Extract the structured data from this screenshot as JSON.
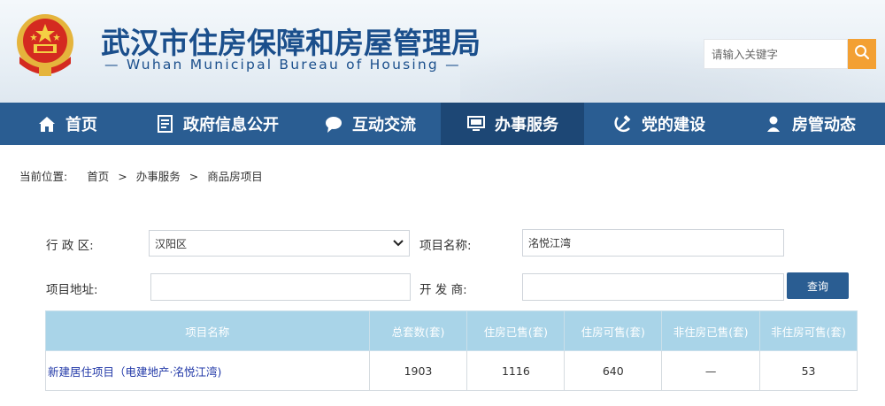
{
  "header": {
    "title_cn": "武汉市住房保障和房屋管理局",
    "title_en": "— Wuhan Municipal Bureau of Housing —",
    "search_placeholder": "请输入关键字",
    "emblem_icon": "national-emblem-icon",
    "search_icon": "search-icon"
  },
  "nav": {
    "items": [
      {
        "label": "首页",
        "icon": "home-icon"
      },
      {
        "label": "政府信息公开",
        "icon": "document-icon"
      },
      {
        "label": "互动交流",
        "icon": "chat-bubble-icon"
      },
      {
        "label": "办事服务",
        "icon": "monitor-icon",
        "active": true
      },
      {
        "label": "党的建设",
        "icon": "hammer-sickle-icon"
      },
      {
        "label": "房管动态",
        "icon": "person-badge-icon"
      }
    ]
  },
  "breadcrumb": {
    "label": "当前位置:",
    "items": [
      "首页",
      "办事服务",
      "商品房项目"
    ],
    "separator": ">"
  },
  "form": {
    "district_label": "行 政 区:",
    "district_value": "汉阳区",
    "project_name_label": "项目名称:",
    "project_name_value": "洺悦江湾",
    "address_label": "项目地址:",
    "address_value": "",
    "developer_label": "开 发 商:",
    "developer_value": "",
    "query_button": "查询"
  },
  "table": {
    "headers": [
      "项目名称",
      "总套数(套)",
      "住房已售(套)",
      "住房可售(套)",
      "非住房已售(套)",
      "非住房可售(套)"
    ],
    "rows": [
      [
        "新建居住项目（电建地产·洺悦江湾)",
        "1903",
        "1116",
        "640",
        "—",
        "53"
      ]
    ]
  },
  "colors": {
    "brand_blue": "#1b4f8c",
    "nav_bg": "#2a5d92",
    "nav_active": "#1d4775",
    "search_orange": "#f3a033",
    "table_header": "#a9d4e8",
    "link_blue": "#2239a8"
  }
}
